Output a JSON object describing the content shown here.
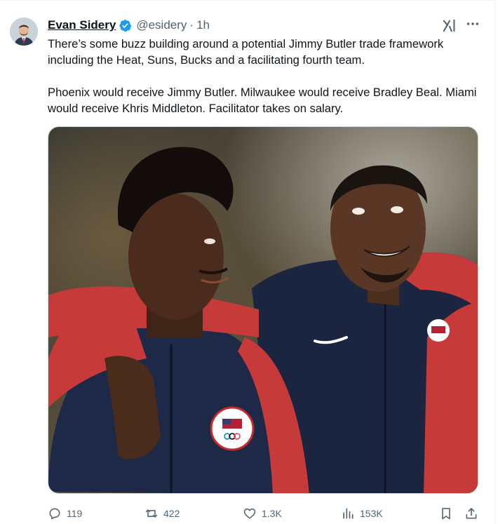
{
  "author": {
    "name": "Evan Sidery",
    "handle": "@esidery",
    "separator": "·",
    "time": "1h",
    "verified": true
  },
  "tweet": {
    "paragraph1": "There’s some buzz building around a potential Jimmy Butler trade framework including the Heat, Suns, Bucks and a facilitating fourth team.",
    "paragraph2": "Phoenix would receive Jimmy Butler. Milwaukee would receive Bradley Beal. Miami would receive Khris Middleton. Facilitator takes on salary."
  },
  "actions": {
    "replies": "119",
    "reposts": "422",
    "likes": "1.3K",
    "views": "153K"
  },
  "colors": {
    "accent": "#1d9bf0",
    "muted": "#536471",
    "text": "#0f1419"
  },
  "icons": [
    "verified-badge-icon",
    "grok-icon",
    "more-icon",
    "reply-icon",
    "repost-icon",
    "like-icon",
    "views-icon",
    "bookmark-icon",
    "share-icon"
  ]
}
